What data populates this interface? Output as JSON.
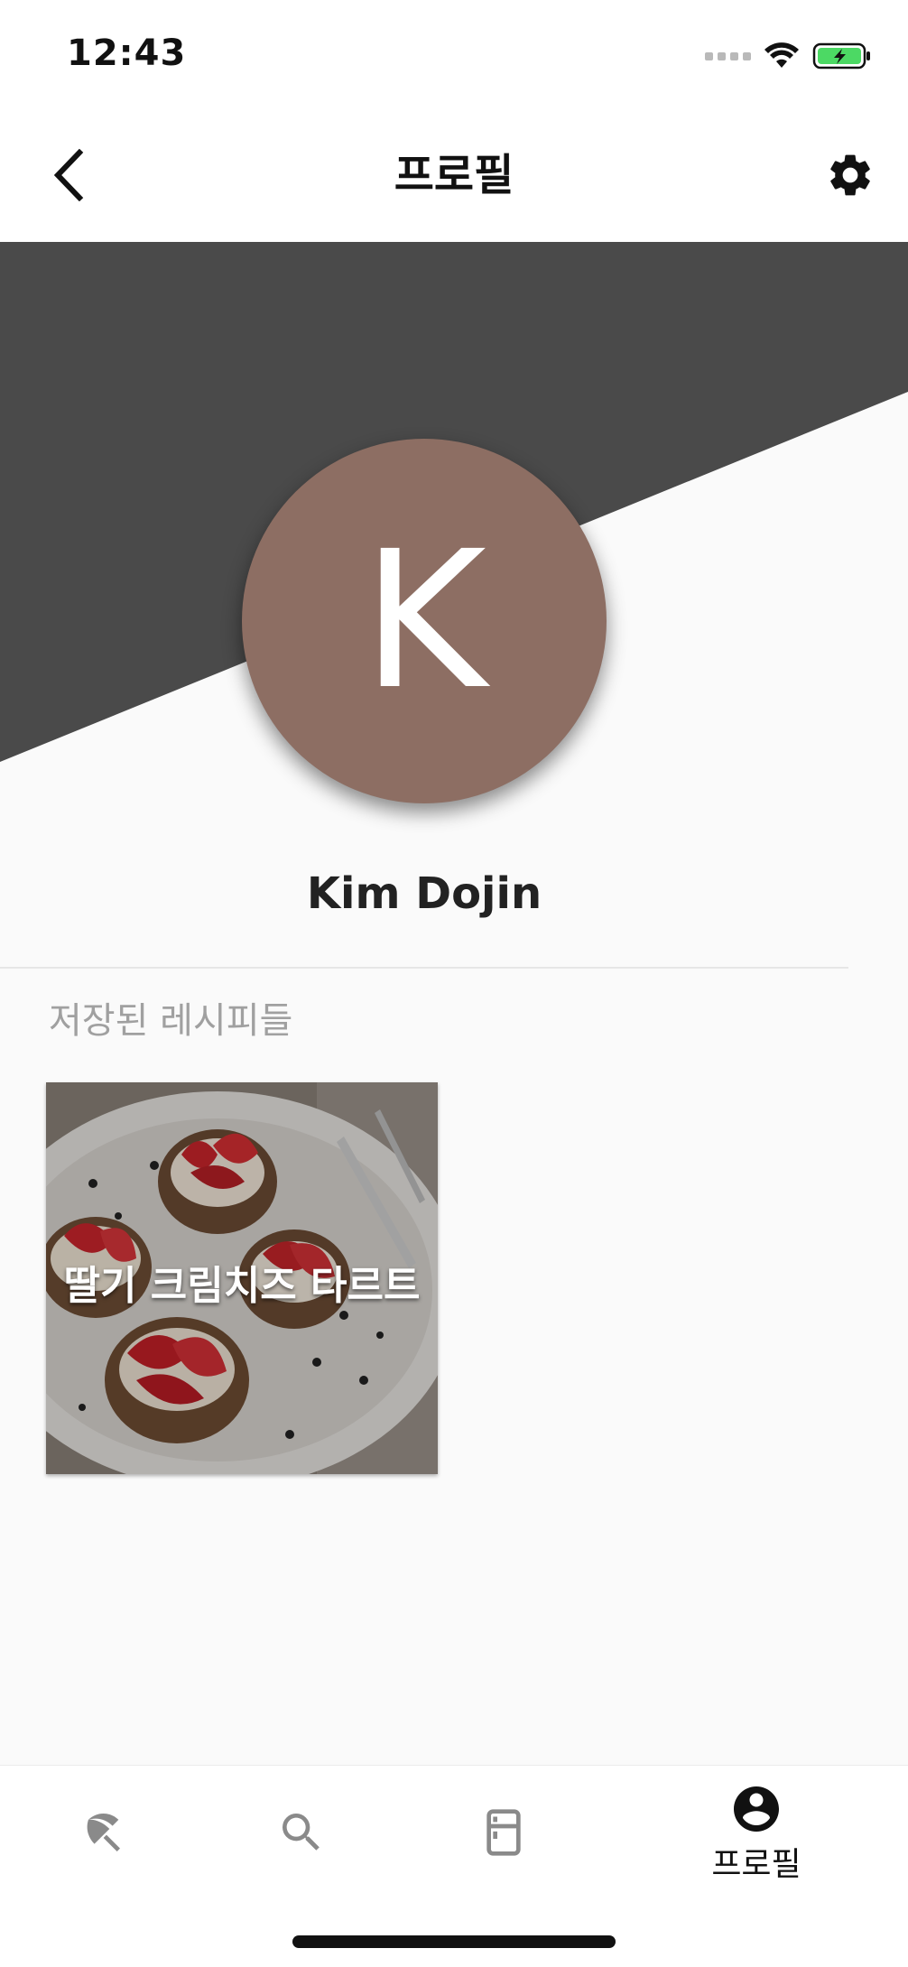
{
  "status_bar": {
    "time": "12:43"
  },
  "header": {
    "title": "프로필"
  },
  "profile": {
    "initial": "K",
    "name": "Kim Dojin"
  },
  "saved_section": {
    "label": "저장된 레시피들"
  },
  "saved_recipes": [
    {
      "title": "딸기 크림치즈 타르트"
    }
  ],
  "bottom_nav": {
    "items": [
      {
        "icon": "utensils-icon",
        "label": ""
      },
      {
        "icon": "search-icon",
        "label": ""
      },
      {
        "icon": "fridge-icon",
        "label": ""
      },
      {
        "icon": "account-circle-icon",
        "label": "프로필"
      }
    ]
  },
  "colors": {
    "hero_dark": "#4a4a4a",
    "avatar_bg": "#8d6e63",
    "background": "#fafafa",
    "battery_green": "#4cd964"
  }
}
